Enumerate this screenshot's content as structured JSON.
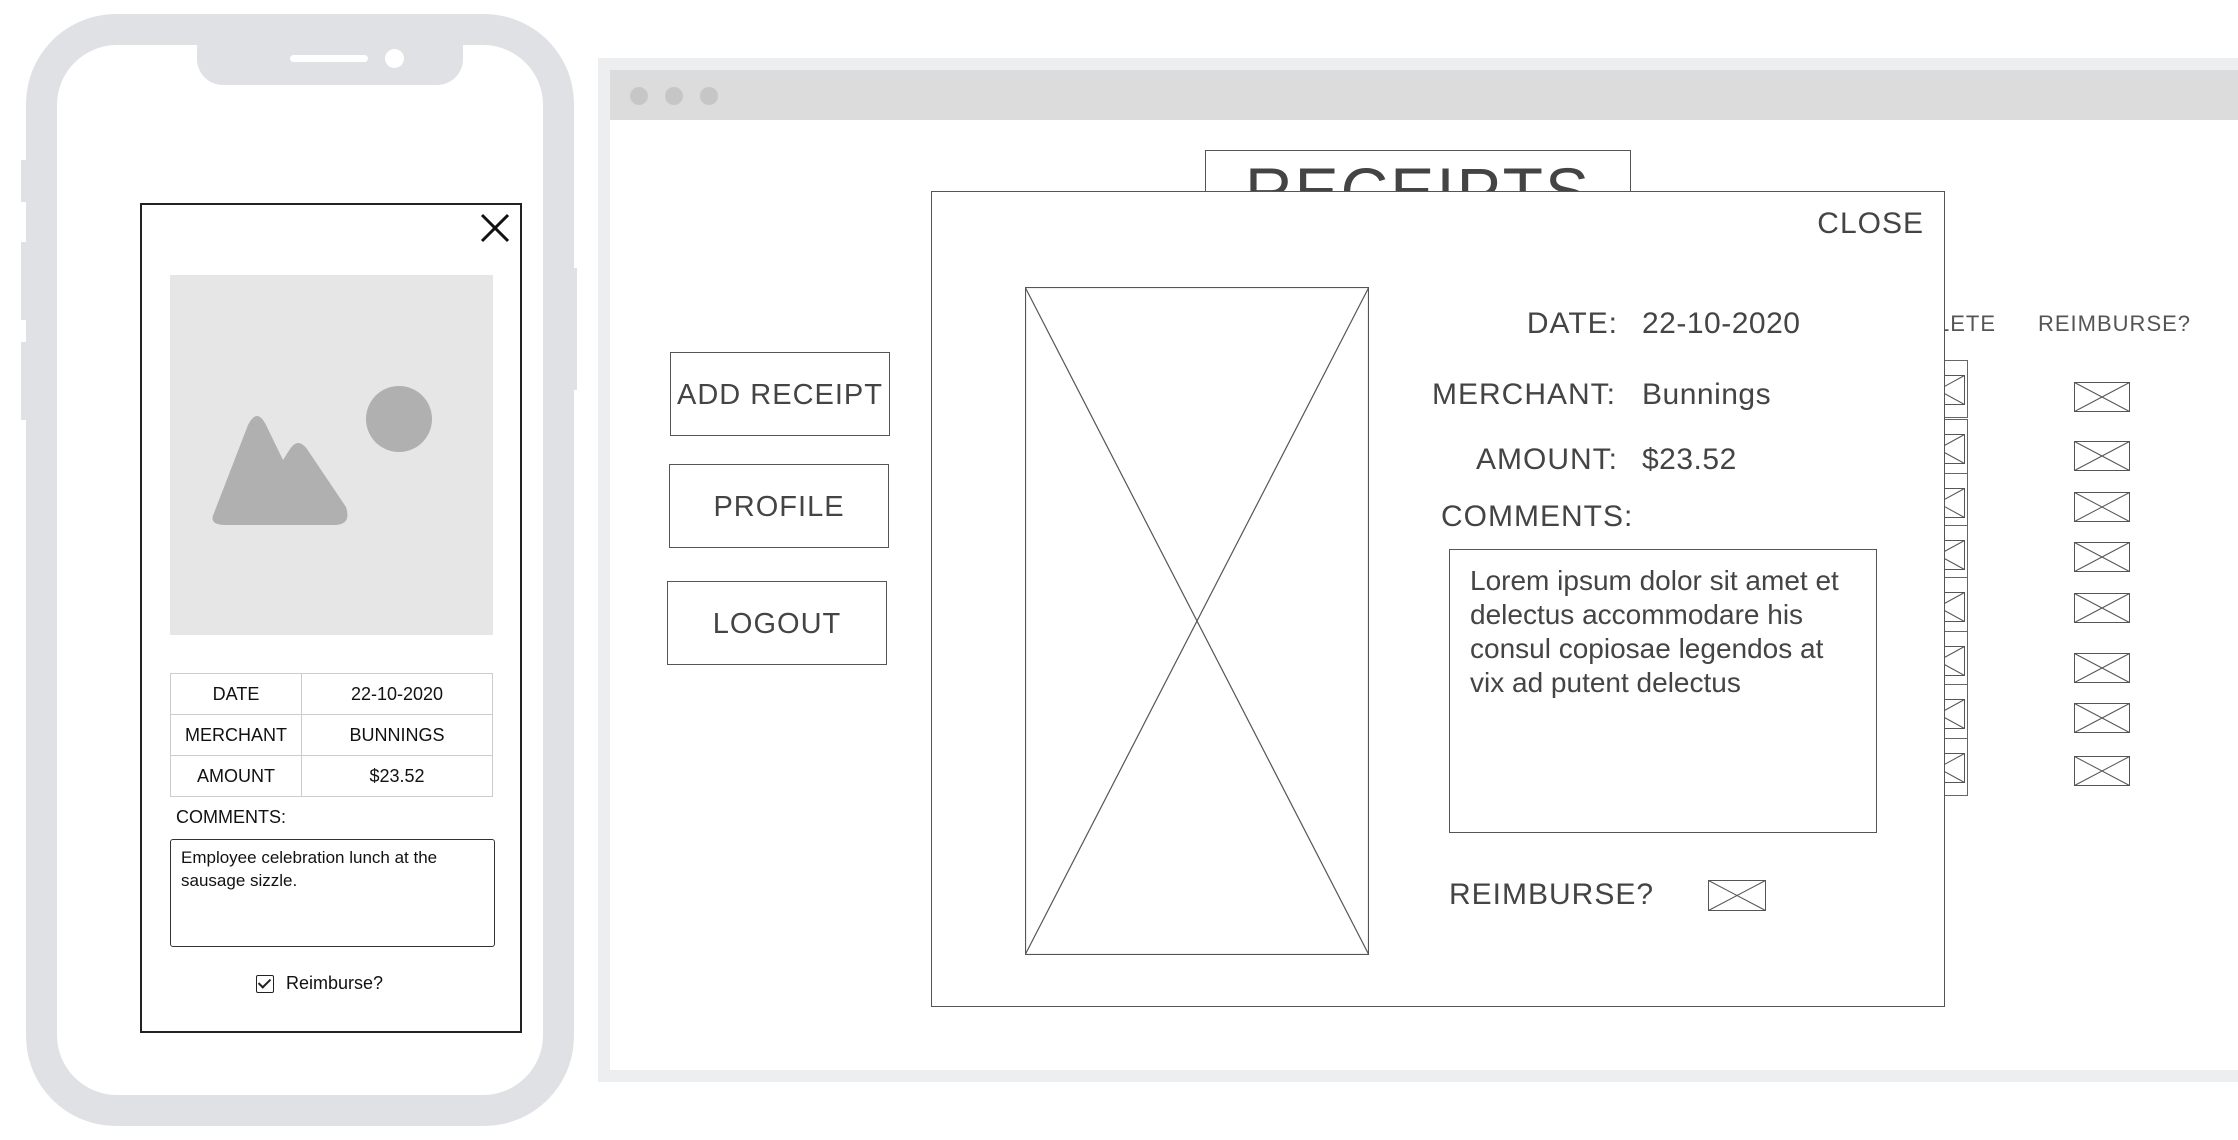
{
  "phone": {
    "close_icon": "close-x-icon",
    "image_icon": "image-placeholder-icon",
    "details": [
      {
        "label": "DATE",
        "value": "22-10-2020"
      },
      {
        "label": "MERCHANT",
        "value": "BUNNINGS"
      },
      {
        "label": "AMOUNT",
        "value": "$23.52"
      }
    ],
    "comments_label": "COMMENTS:",
    "comments_text": "Employee celebration lunch at the sausage sizzle.",
    "reimburse_label": "Reimburse?",
    "reimburse_checked": true
  },
  "browser": {
    "page_title": "RECEIPTS",
    "nav": {
      "add_receipt": "ADD RECEIPT",
      "profile": "PROFILE",
      "logout": "LOGOUT"
    },
    "columns": {
      "delete": "LETE",
      "reimburse": "REIMBURSE?"
    },
    "row_count": 8
  },
  "modal": {
    "close_label": "CLOSE",
    "date_label": "DATE:",
    "date_value": "22-10-2020",
    "merchant_label": "MERCHANT:",
    "merchant_value": "Bunnings",
    "amount_label": "AMOUNT:",
    "amount_value": "$23.52",
    "comments_label": "COMMENTS:",
    "comments_text": "Lorem ipsum dolor sit amet et delectus accommodare his consul copiosae legendos at vix ad putent delectus",
    "reimburse_label": "REIMBURSE?",
    "image_icon": "image-placeholder-x-icon"
  },
  "colors": {
    "device_frame": "#dfe1e5",
    "wire": "#555555",
    "placeholder": "#e6e6e6"
  }
}
